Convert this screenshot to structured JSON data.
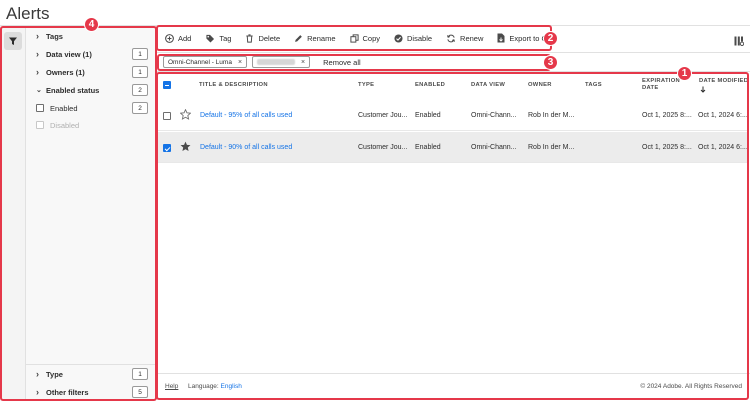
{
  "app": {
    "title": "Alerts"
  },
  "rail": {
    "filter_icon": "filter-icon"
  },
  "callouts": {
    "c1": "1",
    "c2": "2",
    "c3": "3",
    "c4": "4"
  },
  "filters": {
    "tags": {
      "label": "Tags"
    },
    "data_view": {
      "label": "Data view  (1)",
      "count": "1"
    },
    "owners": {
      "label": "Owners  (1)",
      "count": "1"
    },
    "enabled_status": {
      "label": "Enabled status",
      "count": "2",
      "options": [
        {
          "label": "Enabled",
          "count": "2"
        },
        {
          "label": "Disabled"
        }
      ]
    },
    "type": {
      "label": "Type",
      "count": "1"
    },
    "other": {
      "label": "Other filters",
      "count": "5"
    }
  },
  "toolbar": {
    "add": "Add",
    "tag": "Tag",
    "delete": "Delete",
    "rename": "Rename",
    "copy": "Copy",
    "disable": "Disable",
    "renew": "Renew",
    "export": "Export to CSV"
  },
  "chips": [
    {
      "label": "Omni-Channel - Luma"
    },
    {
      "label": ""
    }
  ],
  "remove_all": "Remove all",
  "table": {
    "headers": {
      "title": "TITLE & DESCRIPTION",
      "type": "TYPE",
      "enabled": "ENABLED",
      "data_view": "DATA VIEW",
      "owner": "OWNER",
      "tags": "TAGS",
      "expiration_1": "EXPIRATION",
      "expiration_2": "DATE",
      "modified_1": "DATE MODIFIED",
      "sort_icon": "arrow-down-icon"
    },
    "rows": [
      {
        "title": "Default - 95% of all calls used",
        "type": "Customer Jou...",
        "enabled": "Enabled",
        "data_view": "Omni-Chann...",
        "owner": "Rob In der M...",
        "tags": "",
        "expiration": "Oct 1, 2025 8:...",
        "modified": "Oct 1, 2024 6:...",
        "checked": false,
        "starred": false
      },
      {
        "title": "Default - 90% of all calls used",
        "type": "Customer Jou...",
        "enabled": "Enabled",
        "data_view": "Omni-Chann...",
        "owner": "Rob In der M...",
        "tags": "",
        "expiration": "Oct 1, 2025 8:...",
        "modified": "Oct 1, 2024 6:...",
        "checked": true,
        "starred": true
      }
    ]
  },
  "footer": {
    "help": "Help",
    "language_label": "Language:",
    "language_value": "English",
    "copyright": "© 2024 Adobe. All Rights Reserved"
  },
  "colors": {
    "accent": "#1473e6",
    "callout": "#e5384a"
  }
}
